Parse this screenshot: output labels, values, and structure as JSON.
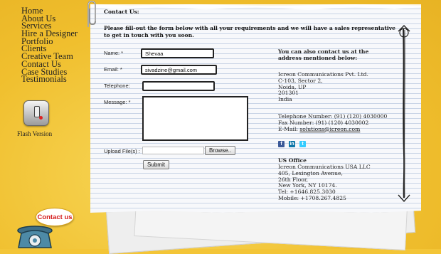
{
  "nav": [
    "Home",
    "About Us",
    "Services",
    "Hire a Designer",
    "Portfolio",
    "Clients",
    "Creative Team",
    "Contact Us",
    "Case Studies",
    "Testimonials"
  ],
  "flash": {
    "label": "Flash Version"
  },
  "contact_bubble": "Contact us",
  "page": {
    "title": "Contact Us:",
    "intro": "Please fill-out the form below with all your requirements and we will have a sales representative to get in touch with you soon."
  },
  "form": {
    "name_label": "Name: *",
    "name_value": "Shevaa",
    "email_label": "Email: *",
    "email_value": "sivadzine@gmail.com",
    "telephone_label": "Telephone:",
    "telephone_value": "",
    "message_label": "Message: *",
    "message_value": "",
    "upload_label": "Upload File(s) :",
    "browse_label": "Browse..",
    "submit_label": "Submit"
  },
  "contact_info": {
    "heading": "You can also contact us at the address mentioned below:",
    "address": [
      "Icreon Communications Pvt. Ltd.",
      "C-103, Sector 2,",
      "Noida, UP",
      "201301",
      "India"
    ],
    "phone": "Telephone Number: (91) (120) 4030000",
    "fax": "Fax Number: (91) (120) 4030002",
    "email_prefix": "E-Mail: ",
    "email": "solutions@icreon.com",
    "social_icons": [
      "facebook-icon",
      "linkedin-icon",
      "twitter-icon"
    ],
    "us_office": {
      "heading": "US Office",
      "lines": [
        "Icreon Communications USA LLC",
        "405, Lexington Avenue,",
        "26th Floor,",
        "New York, NY 10174.",
        "Tel: +1646.825.3030",
        "Mobile: +1708.267.4825"
      ]
    }
  },
  "colors": {
    "background": "#f3c537",
    "accent_red": "#d41b1b",
    "facebook": "#3b5998",
    "linkedin": "#0e76a8",
    "twitter": "#33ccff"
  }
}
